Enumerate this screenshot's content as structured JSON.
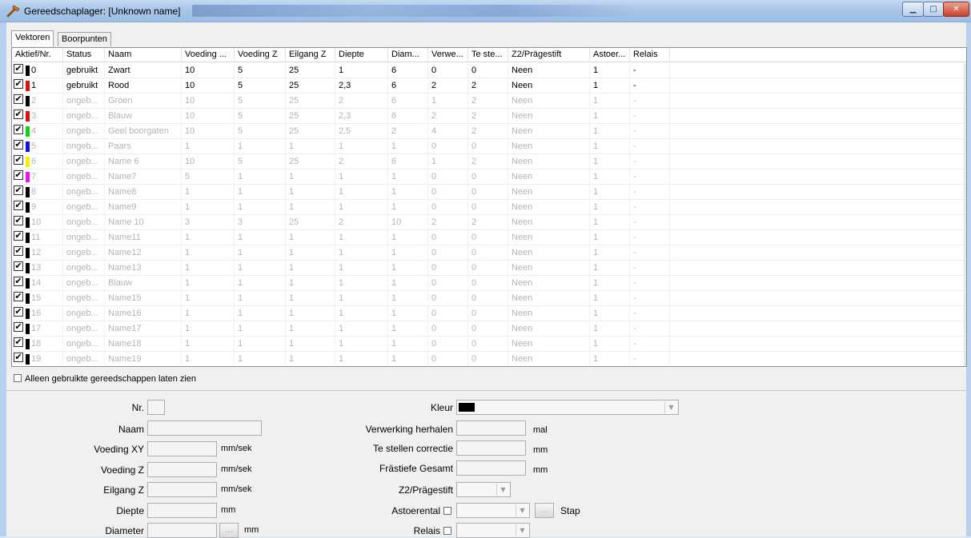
{
  "window": {
    "title": "Gereedschaplager: [Unknown name]",
    "controls": {
      "minimize": "▁",
      "maximize": "□",
      "close": "✕"
    }
  },
  "tabs": [
    {
      "label": "Vektoren",
      "active": true
    },
    {
      "label": "Boorpunten",
      "active": false
    }
  ],
  "grid": {
    "columns": [
      "Aktief/Nr.",
      "Status",
      "Naam",
      "Voeding ...",
      "Voeding Z",
      "Eilgang Z",
      "Diepte",
      "Diam...",
      "Verwe...",
      "Te ste...",
      "Z2/Prägestift",
      "Astoer...",
      "Relais"
    ],
    "rows": [
      {
        "checked": "✔",
        "color": "#000000",
        "nr": "0",
        "used": true,
        "cells": [
          "gebruikt",
          "Zwart",
          "10",
          "5",
          "25",
          "1",
          "6",
          "0",
          "0",
          "Neen",
          "1",
          "-"
        ]
      },
      {
        "checked": "✔",
        "color": "#e01010",
        "nr": "1",
        "used": true,
        "cells": [
          "gebruikt",
          "Rood",
          "10",
          "5",
          "25",
          "2,3",
          "6",
          "2",
          "2",
          "Neen",
          "1",
          "-"
        ]
      },
      {
        "checked": "✔",
        "color": "#000000",
        "nr": "2",
        "used": false,
        "cells": [
          "ongeb...",
          "Groen",
          "10",
          "5",
          "25",
          "2",
          "6",
          "1",
          "2",
          "Neen",
          "1",
          "-"
        ]
      },
      {
        "checked": "✔",
        "color": "#e01010",
        "nr": "3",
        "used": false,
        "cells": [
          "ongeb...",
          "Blauw",
          "10",
          "5",
          "25",
          "2,3",
          "6",
          "2",
          "2",
          "Neen",
          "1",
          "-"
        ]
      },
      {
        "checked": "✔",
        "color": "#10d010",
        "nr": "4",
        "used": false,
        "cells": [
          "ongeb...",
          "Geel boorgaten",
          "10",
          "5",
          "25",
          "2,5",
          "2",
          "4",
          "2",
          "Neen",
          "1",
          "-"
        ]
      },
      {
        "checked": "✔",
        "color": "#1010e8",
        "nr": "5",
        "used": false,
        "cells": [
          "ongeb...",
          "Paars",
          "1",
          "1",
          "1",
          "1",
          "1",
          "0",
          "0",
          "Neen",
          "1",
          "-"
        ]
      },
      {
        "checked": "✔",
        "color": "#f2f200",
        "nr": "6",
        "used": false,
        "cells": [
          "ongeb...",
          "Name 6",
          "10",
          "5",
          "25",
          "2",
          "6",
          "1",
          "2",
          "Neen",
          "1",
          "-"
        ]
      },
      {
        "checked": "✔",
        "color": "#f010f0",
        "nr": "7",
        "used": false,
        "cells": [
          "ongeb...",
          "Name7",
          "5",
          "1",
          "1",
          "1",
          "1",
          "0",
          "0",
          "Neen",
          "1",
          "-"
        ]
      },
      {
        "checked": "✔",
        "color": "#000000",
        "nr": "8",
        "used": false,
        "cells": [
          "ongeb...",
          "Name8",
          "1",
          "1",
          "1",
          "1",
          "1",
          "0",
          "0",
          "Neen",
          "1",
          "-"
        ]
      },
      {
        "checked": "✔",
        "color": "#000000",
        "nr": "9",
        "used": false,
        "cells": [
          "ongeb...",
          "Name9",
          "1",
          "1",
          "1",
          "1",
          "1",
          "0",
          "0",
          "Neen",
          "1",
          "-"
        ]
      },
      {
        "checked": "✔",
        "color": "#000000",
        "nr": "10",
        "used": false,
        "cells": [
          "ongeb...",
          "Name 10",
          "3",
          "3",
          "25",
          "2",
          "10",
          "2",
          "2",
          "Neen",
          "1",
          "-"
        ]
      },
      {
        "checked": "✔",
        "color": "#000000",
        "nr": "11",
        "used": false,
        "cells": [
          "ongeb...",
          "Name11",
          "1",
          "1",
          "1",
          "1",
          "1",
          "0",
          "0",
          "Neen",
          "1",
          "-"
        ]
      },
      {
        "checked": "✔",
        "color": "#000000",
        "nr": "12",
        "used": false,
        "cells": [
          "ongeb...",
          "Name12",
          "1",
          "1",
          "1",
          "1",
          "1",
          "0",
          "0",
          "Neen",
          "1",
          "-"
        ]
      },
      {
        "checked": "✔",
        "color": "#000000",
        "nr": "13",
        "used": false,
        "cells": [
          "ongeb...",
          "Name13",
          "1",
          "1",
          "1",
          "1",
          "1",
          "0",
          "0",
          "Neen",
          "1",
          "-"
        ]
      },
      {
        "checked": "✔",
        "color": "#000000",
        "nr": "14",
        "used": false,
        "cells": [
          "ongeb...",
          "Blauw",
          "1",
          "1",
          "1",
          "1",
          "1",
          "0",
          "0",
          "Neen",
          "1",
          "-"
        ]
      },
      {
        "checked": "✔",
        "color": "#000000",
        "nr": "15",
        "used": false,
        "cells": [
          "ongeb...",
          "Name15",
          "1",
          "1",
          "1",
          "1",
          "1",
          "0",
          "0",
          "Neen",
          "1",
          "-"
        ]
      },
      {
        "checked": "✔",
        "color": "#000000",
        "nr": "16",
        "used": false,
        "cells": [
          "ongeb...",
          "Name16",
          "1",
          "1",
          "1",
          "1",
          "1",
          "0",
          "0",
          "Neen",
          "1",
          "-"
        ]
      },
      {
        "checked": "✔",
        "color": "#000000",
        "nr": "17",
        "used": false,
        "cells": [
          "ongeb...",
          "Name17",
          "1",
          "1",
          "1",
          "1",
          "1",
          "0",
          "0",
          "Neen",
          "1",
          "-"
        ]
      },
      {
        "checked": "✔",
        "color": "#000000",
        "nr": "18",
        "used": false,
        "cells": [
          "ongeb...",
          "Name18",
          "1",
          "1",
          "1",
          "1",
          "1",
          "0",
          "0",
          "Neen",
          "1",
          "-"
        ]
      },
      {
        "checked": "✔",
        "color": "#000000",
        "nr": "19",
        "used": false,
        "cells": [
          "ongeb...",
          "Name19",
          "1",
          "1",
          "1",
          "1",
          "1",
          "0",
          "0",
          "Neen",
          "1",
          "-"
        ]
      }
    ]
  },
  "filter": {
    "label": "Alleen gebruikte gereedschappen laten zien"
  },
  "detail": {
    "nr_label": "Nr.",
    "naam_label": "Naam",
    "voeding_xy_label": "Voeding XY",
    "voeding_z_label": "Voeding Z",
    "eilgang_z_label": "Eilgang Z",
    "diepte_label": "Diepte",
    "diameter_label": "Diameter",
    "unit_mm_sek": "mm/sek",
    "unit_mm": "mm",
    "unit_mal": "mal",
    "dots": "...",
    "kleur_label": "Kleur",
    "verwerking_label": "Verwerking herhalen",
    "correctie_label": "Te stellen correctie",
    "frastiefe_label": "Frästiefe Gesamt",
    "z2_label": "Z2/Prägestift",
    "astoerental_label": "Astoerental",
    "stap_label": "Stap",
    "relais_label": "Relais",
    "kleur_value_color": "#000000"
  }
}
